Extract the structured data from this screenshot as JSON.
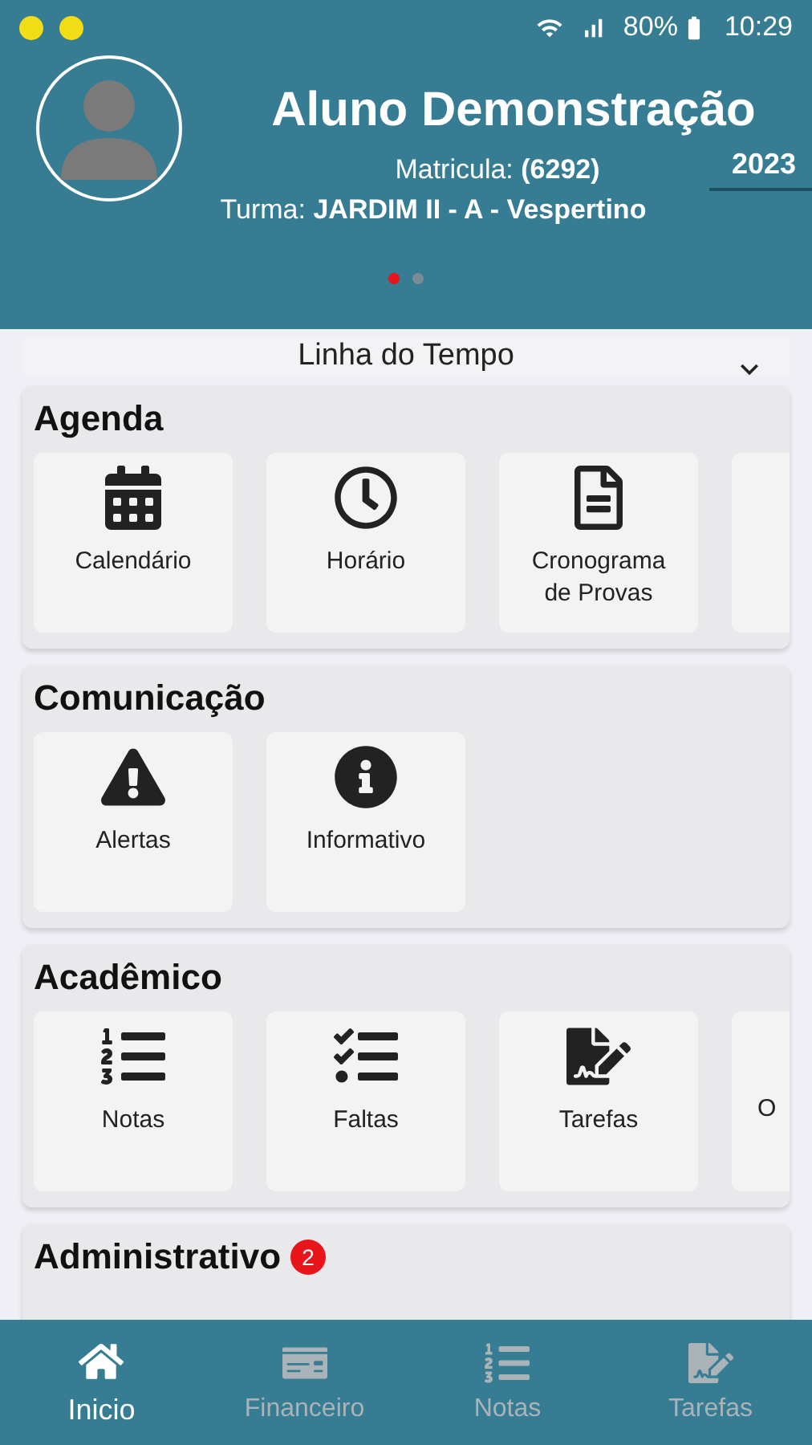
{
  "status_bar": {
    "battery": "80%",
    "time": "10:29"
  },
  "profile": {
    "name": "Aluno Demonstração",
    "registration_label": "Matricula:",
    "registration": "(6292)",
    "class_label": "Turma:",
    "class": "JARDIM II - A - Vespertino",
    "year": "2023"
  },
  "pager": [
    {
      "selected": true
    },
    {
      "selected": false
    }
  ],
  "timeline": {
    "label": "Linha do Tempo"
  },
  "sections": [
    {
      "title": "Agenda",
      "tiles": [
        {
          "kind": "full",
          "label": "Calendário"
        },
        {
          "kind": "full",
          "label": "Horário"
        },
        {
          "kind": "full",
          "label": "Cronograma de Provas"
        },
        {
          "kind": "partial"
        }
      ]
    },
    {
      "title": "Comunicação",
      "tiles": [
        {
          "kind": "full",
          "label": "Alertas"
        },
        {
          "kind": "full",
          "label": "Informativo"
        }
      ]
    },
    {
      "title": "Acadêmico",
      "tiles": [
        {
          "kind": "full",
          "label": "Notas"
        },
        {
          "kind": "full",
          "label": "Faltas"
        },
        {
          "kind": "full",
          "label": "Tarefas"
        },
        {
          "kind": "partial",
          "label": "O"
        }
      ]
    },
    {
      "title": "Administrativo",
      "badge": "2"
    }
  ],
  "nav": [
    {
      "label": "Inicio",
      "selected": true
    },
    {
      "label": "Financeiro",
      "selected": false
    },
    {
      "label": "Notas",
      "selected": false
    },
    {
      "label": "Tarefas",
      "selected": false
    }
  ]
}
